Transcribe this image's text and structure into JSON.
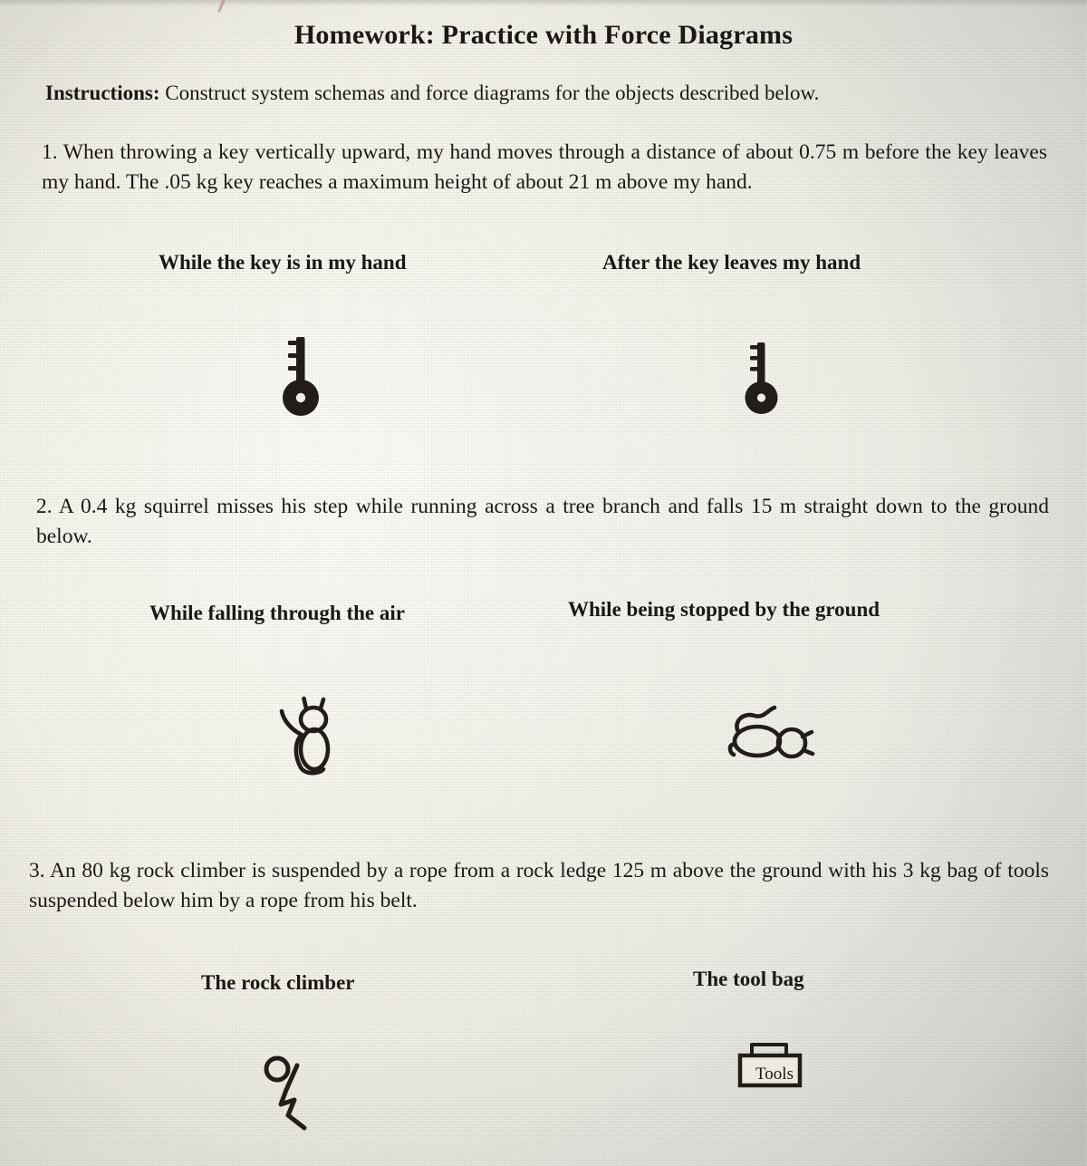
{
  "document": {
    "title": "Homework: Practice with Force Diagrams",
    "instructions_label": "Instructions:",
    "instructions_text": " Construct system schemas and force diagrams for the objects described below."
  },
  "problems": [
    {
      "number": "1.",
      "text": "1.  When throwing a key vertically upward, my hand moves through a distance of about 0.75 m before the key leaves my hand.  The .05 kg key reaches a maximum height of about 21 m above my hand.",
      "columns": [
        {
          "heading": "While the key is in my hand",
          "sketch": "key-icon"
        },
        {
          "heading": "After the key leaves my hand",
          "sketch": "key-icon"
        }
      ]
    },
    {
      "number": "2.",
      "text": "2. A 0.4 kg squirrel misses his step while running across a tree branch and falls 15 m straight down to the ground below.",
      "columns": [
        {
          "heading": "While falling through the air",
          "sketch": "squirrel-upright-icon"
        },
        {
          "heading": "While being stopped by the ground",
          "sketch": "squirrel-fallen-icon"
        }
      ]
    },
    {
      "number": "3.",
      "text": "3.  An 80 kg rock climber is suspended by a rope from a rock ledge 125 m above the ground with his 3 kg bag of tools suspended below him by a rope from his belt.",
      "columns": [
        {
          "heading": "The rock climber",
          "sketch": "stick-figure-climber-icon"
        },
        {
          "heading": "The tool bag",
          "sketch": "tool-bag-icon"
        }
      ]
    }
  ],
  "sketches": {
    "tool_bag_label": "Tools"
  },
  "colors": {
    "ink": "#221d19",
    "paper": "#ecead f",
    "stray_mark": "#b98a84"
  }
}
